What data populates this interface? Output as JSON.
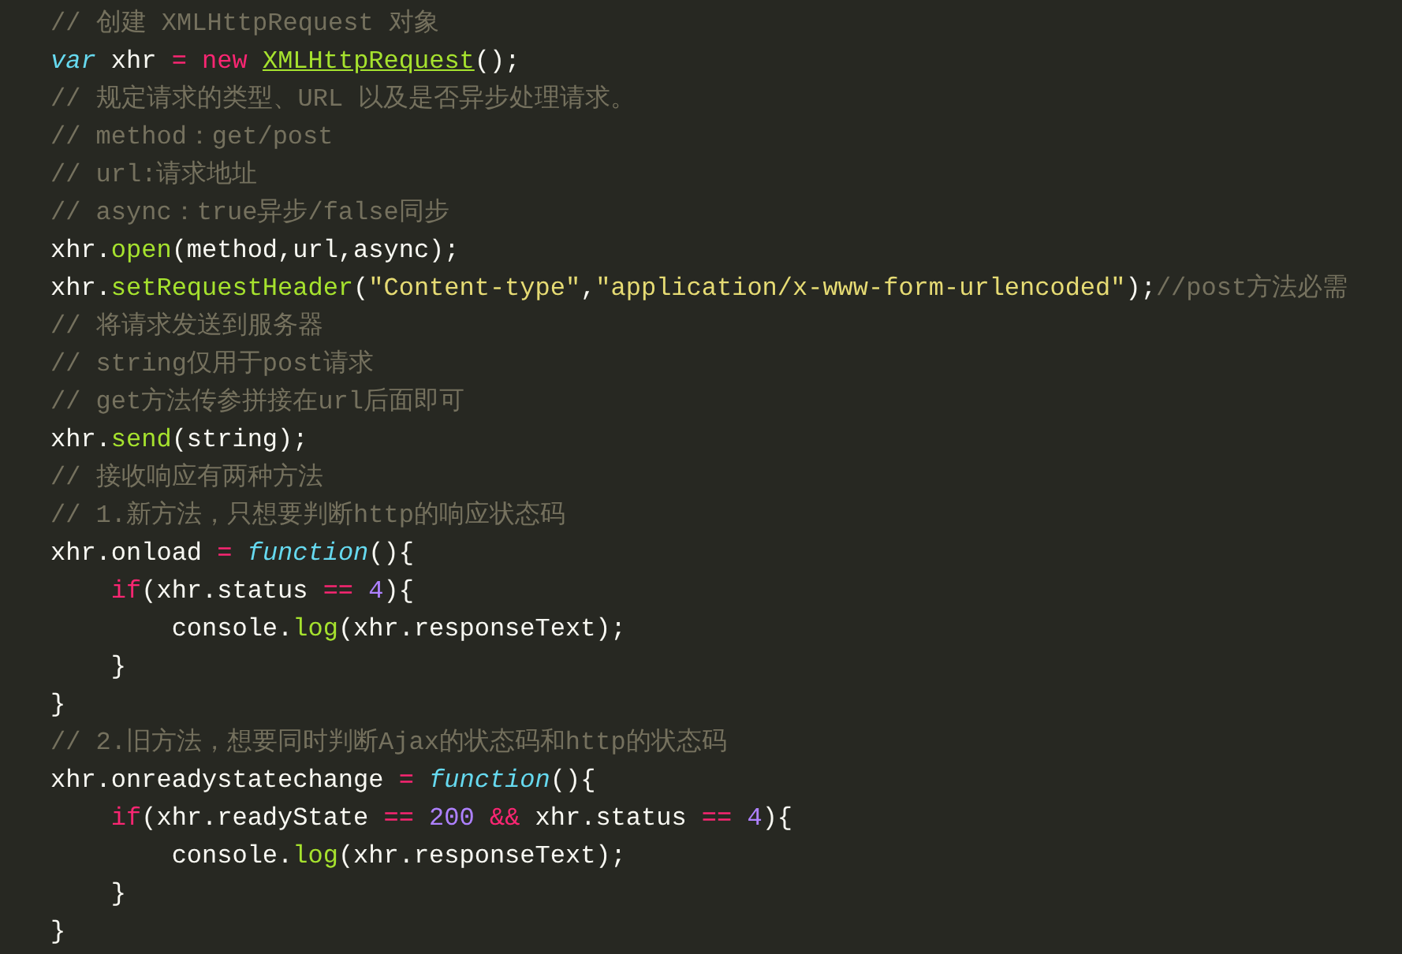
{
  "editor": {
    "lines": [
      {
        "tokens": [
          {
            "kind": "comment",
            "text": "// 创建 XMLHttpRequest 对象"
          }
        ]
      },
      {
        "tokens": [
          {
            "kind": "storage",
            "text": "var"
          },
          {
            "kind": "plain",
            "text": " xhr "
          },
          {
            "kind": "operator",
            "text": "="
          },
          {
            "kind": "operator",
            "text": " new"
          },
          {
            "kind": "class",
            "text": " XMLHttpRequest"
          },
          {
            "kind": "plain",
            "text": "();"
          }
        ]
      },
      {
        "tokens": [
          {
            "kind": "comment",
            "text": "// 规定请求的类型、URL 以及是否异步处理请求。"
          }
        ]
      },
      {
        "tokens": [
          {
            "kind": "comment",
            "text": "// method：get/post"
          }
        ]
      },
      {
        "tokens": [
          {
            "kind": "comment",
            "text": "// url:请求地址"
          }
        ]
      },
      {
        "tokens": [
          {
            "kind": "comment",
            "text": "// async：true异步/false同步"
          }
        ]
      },
      {
        "tokens": [
          {
            "kind": "plain",
            "text": "xhr."
          },
          {
            "kind": "function",
            "text": "open"
          },
          {
            "kind": "plain",
            "text": "(method,url,async);"
          }
        ]
      },
      {
        "tokens": [
          {
            "kind": "plain",
            "text": "xhr."
          },
          {
            "kind": "function",
            "text": "setRequestHeader"
          },
          {
            "kind": "plain",
            "text": "("
          },
          {
            "kind": "string",
            "text": "\"Content-type\""
          },
          {
            "kind": "plain",
            "text": ","
          },
          {
            "kind": "string",
            "text": "\"application/x-www-form-urlencoded\""
          },
          {
            "kind": "plain",
            "text": ");"
          },
          {
            "kind": "comment",
            "text": "//post方法必需"
          }
        ]
      },
      {
        "tokens": [
          {
            "kind": "comment",
            "text": "// 将请求发送到服务器"
          }
        ]
      },
      {
        "tokens": [
          {
            "kind": "comment",
            "text": "// string仅用于post请求"
          }
        ]
      },
      {
        "tokens": [
          {
            "kind": "comment",
            "text": "// get方法传参拼接在url后面即可"
          }
        ]
      },
      {
        "tokens": [
          {
            "kind": "plain",
            "text": "xhr."
          },
          {
            "kind": "function",
            "text": "send"
          },
          {
            "kind": "plain",
            "text": "(string);"
          }
        ]
      },
      {
        "tokens": [
          {
            "kind": "comment",
            "text": "// 接收响应有两种方法"
          }
        ]
      },
      {
        "tokens": [
          {
            "kind": "comment",
            "text": "// 1.新方法，只想要判断http的响应状态码"
          }
        ]
      },
      {
        "tokens": [
          {
            "kind": "plain",
            "text": "xhr.onload "
          },
          {
            "kind": "operator",
            "text": "="
          },
          {
            "kind": "storage",
            "text": " function"
          },
          {
            "kind": "plain",
            "text": "(){"
          }
        ]
      },
      {
        "tokens": [
          {
            "kind": "operator",
            "text": "    if"
          },
          {
            "kind": "plain",
            "text": "(xhr.status "
          },
          {
            "kind": "operator",
            "text": "=="
          },
          {
            "kind": "number",
            "text": " 4"
          },
          {
            "kind": "plain",
            "text": "){"
          }
        ]
      },
      {
        "tokens": [
          {
            "kind": "plain",
            "text": "        console."
          },
          {
            "kind": "function",
            "text": "log"
          },
          {
            "kind": "plain",
            "text": "(xhr.responseText);"
          }
        ]
      },
      {
        "tokens": [
          {
            "kind": "plain",
            "text": "    }"
          }
        ]
      },
      {
        "tokens": [
          {
            "kind": "plain",
            "text": "}"
          }
        ]
      },
      {
        "tokens": [
          {
            "kind": "comment",
            "text": "// 2.旧方法，想要同时判断Ajax的状态码和http的状态码"
          }
        ]
      },
      {
        "tokens": [
          {
            "kind": "plain",
            "text": "xhr.onreadystatechange "
          },
          {
            "kind": "operator",
            "text": "="
          },
          {
            "kind": "storage",
            "text": " function"
          },
          {
            "kind": "plain",
            "text": "(){"
          }
        ]
      },
      {
        "tokens": [
          {
            "kind": "operator",
            "text": "    if"
          },
          {
            "kind": "plain",
            "text": "(xhr.readyState "
          },
          {
            "kind": "operator",
            "text": "=="
          },
          {
            "kind": "number",
            "text": " 200"
          },
          {
            "kind": "operator",
            "text": " &&"
          },
          {
            "kind": "plain",
            "text": " xhr.status "
          },
          {
            "kind": "operator",
            "text": "=="
          },
          {
            "kind": "number",
            "text": " 4"
          },
          {
            "kind": "plain",
            "text": "){"
          }
        ]
      },
      {
        "tokens": [
          {
            "kind": "plain",
            "text": "        console."
          },
          {
            "kind": "function",
            "text": "log"
          },
          {
            "kind": "plain",
            "text": "(xhr.responseText);"
          }
        ]
      },
      {
        "tokens": [
          {
            "kind": "plain",
            "text": "    }"
          }
        ]
      },
      {
        "tokens": [
          {
            "kind": "plain",
            "text": "}"
          }
        ]
      }
    ]
  }
}
